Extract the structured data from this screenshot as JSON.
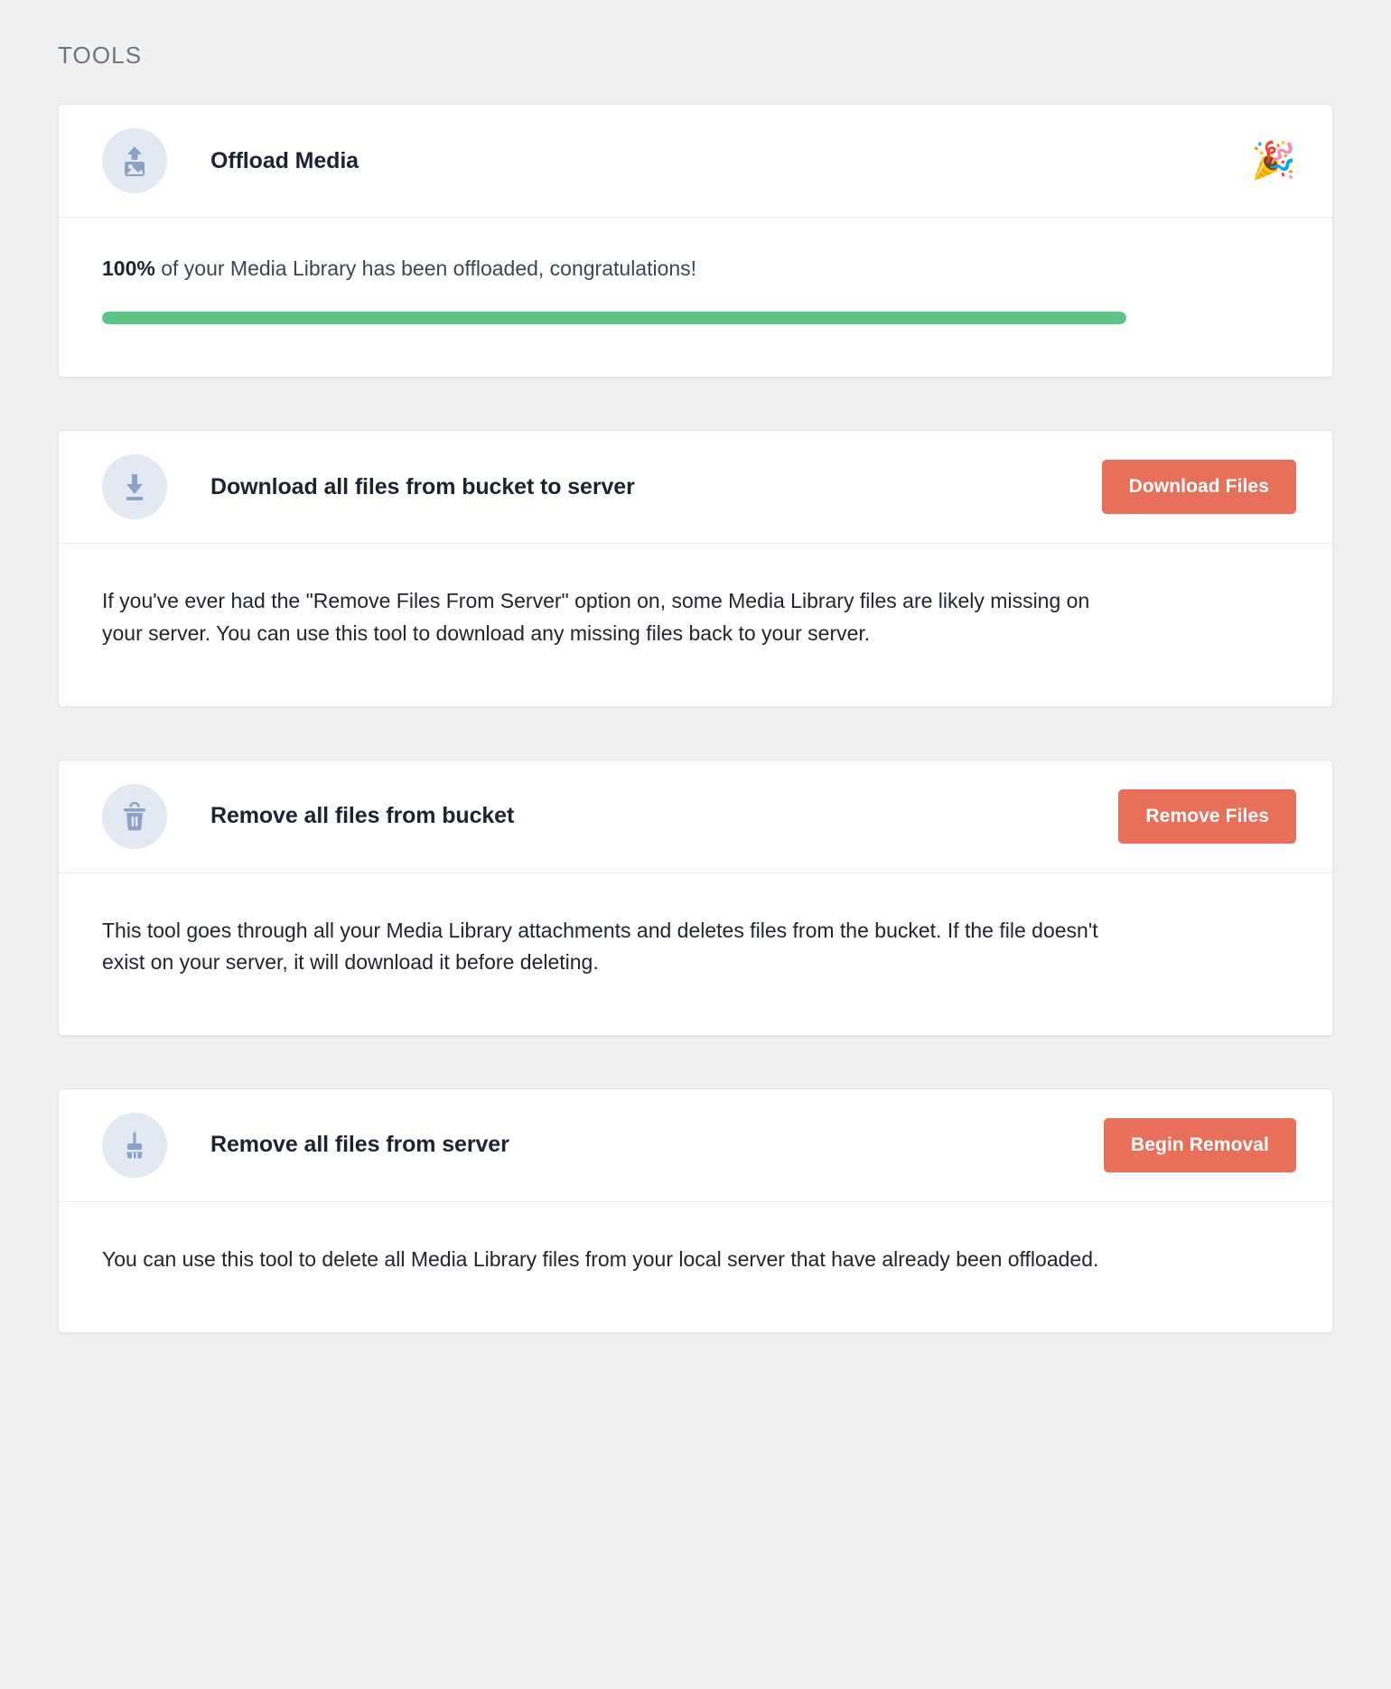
{
  "section": {
    "title": "TOOLS"
  },
  "colors": {
    "page_background": "#f0f0f1",
    "card_background": "#ffffff",
    "section_title": "#6b7684",
    "button_accent": "#e8705a",
    "progress_fill": "#5cc487",
    "progress_track": "#e9ebef",
    "icon_circle": "#e3e9f2",
    "icon_glyph": "#8ba3c7"
  },
  "cards": [
    {
      "id": "offload-media",
      "icon": "image-upload-icon",
      "title": "Offload Media",
      "badge_emoji": "🎉",
      "badge_name": "party-popper-emoji",
      "progress": {
        "percent_label": "100%",
        "percent_value": 100,
        "message": " of your Media Library has been offloaded, congratulations!"
      }
    },
    {
      "id": "download-all-files",
      "icon": "download-icon",
      "title": "Download all files from bucket to server",
      "button_label": "Download Files",
      "description": "If you've ever had the \"Remove Files From Server\" option on, some Media Library files are likely missing on your server. You can use this tool to download any missing files back to your server."
    },
    {
      "id": "remove-all-files-bucket",
      "icon": "trash-icon",
      "title": "Remove all files from bucket",
      "button_label": "Remove Files",
      "description": "This tool goes through all your Media Library attachments and deletes files from the bucket. If the file doesn't exist on your server, it will download it before deleting."
    },
    {
      "id": "remove-all-files-server",
      "icon": "broom-icon",
      "title": "Remove all files from server",
      "button_label": "Begin Removal",
      "description": "You can use this tool to delete all Media Library files from your local server that have already been offloaded."
    }
  ]
}
